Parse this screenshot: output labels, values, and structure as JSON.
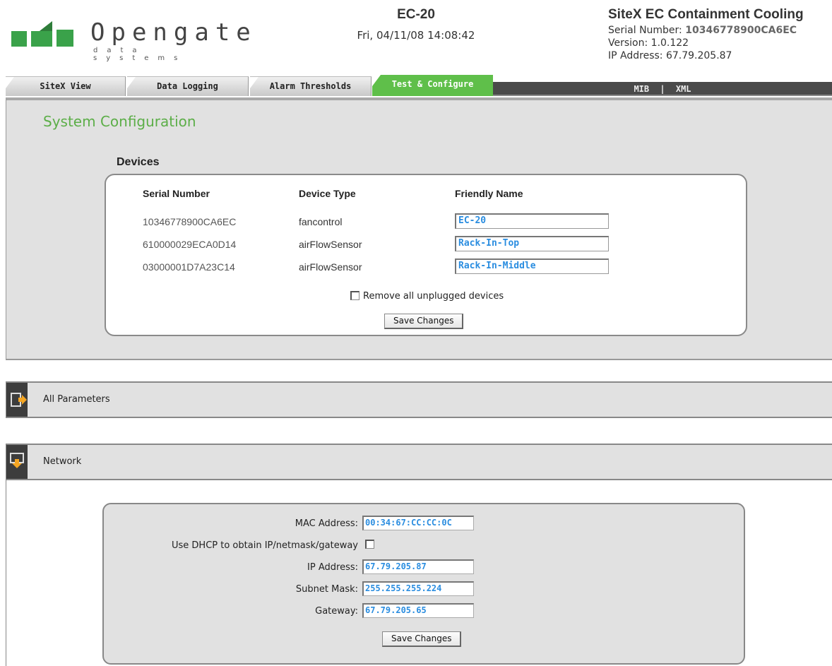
{
  "header": {
    "logo_word": "Opengate",
    "logo_sub": "data systems",
    "device_name": "EC-20",
    "datetime": "Fri, 04/11/08 14:08:42",
    "site_title": "SiteX EC Containment Cooling",
    "serial_label": "Serial Number:",
    "serial_value": "10346778900CA6EC",
    "version_label": "Version:",
    "version_value": "1.0.122",
    "ip_label": "IP Address:",
    "ip_value": "67.79.205.87"
  },
  "tabs": [
    {
      "label": "SiteX View"
    },
    {
      "label": "Data Logging"
    },
    {
      "label": "Alarm Thresholds"
    },
    {
      "label": "Test & Configure"
    }
  ],
  "links": {
    "mib": "MIB",
    "sep": "|",
    "xml": "XML"
  },
  "system_config": {
    "title": "System Configuration",
    "devices_title": "Devices",
    "columns": [
      "Serial Number",
      "Device Type",
      "Friendly Name"
    ],
    "devices": [
      {
        "serial": "10346778900CA6EC",
        "type": "fancontrol",
        "name": "EC-20"
      },
      {
        "serial": "610000029ECA0D14",
        "type": "airFlowSensor",
        "name": "Rack-In-Top"
      },
      {
        "serial": "03000001D7A23C14",
        "type": "airFlowSensor",
        "name": "Rack-In-Middle"
      }
    ],
    "remove_label": "Remove all unplugged devices",
    "save_label": "Save Changes"
  },
  "all_parameters": {
    "label": "All Parameters"
  },
  "network": {
    "label": "Network",
    "mac_label": "MAC Address:",
    "mac_value": "00:34:67:CC:CC:0C",
    "dhcp_label": "Use DHCP to obtain IP/netmask/gateway",
    "ip_label": "IP Address:",
    "ip_value": "67.79.205.87",
    "mask_label": "Subnet Mask:",
    "mask_value": "255.255.255.224",
    "gw_label": "Gateway:",
    "gw_value": "67.79.205.65",
    "save_label": "Save Changes"
  },
  "colors": {
    "accent": "#5fbf4a",
    "value_blue": "#2a8de0"
  }
}
